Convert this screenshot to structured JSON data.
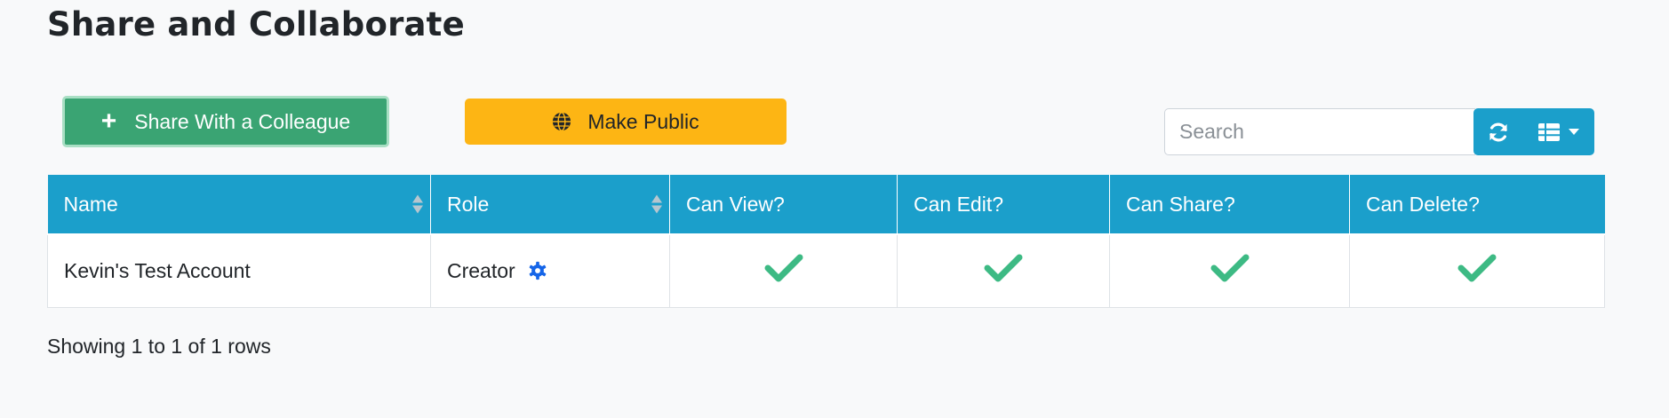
{
  "page": {
    "title": "Share and Collaborate"
  },
  "toolbar": {
    "share_label": "Share With a Colleague",
    "public_label": "Make Public",
    "search_placeholder": "Search",
    "share_icon": "plus-icon",
    "public_icon": "globe-icon",
    "refresh_icon": "refresh-icon",
    "columns_icon": "columns-icon"
  },
  "table": {
    "headers": [
      "Name",
      "Role",
      "Can View?",
      "Can Edit?",
      "Can Share?",
      "Can Delete?"
    ],
    "rows": [
      {
        "name": "Kevin's Test Account",
        "role": "Creator",
        "role_icon": "gear-icon",
        "can_view": true,
        "can_edit": true,
        "can_share": true,
        "can_delete": true
      }
    ]
  },
  "footer": {
    "pagination_text": "Showing 1 to 1 of 1 rows"
  },
  "colors": {
    "primary": "#1b9fcb",
    "success": "#3aa473",
    "warning": "#fdb514",
    "check": "#3dba84",
    "gear": "#1565e8"
  }
}
